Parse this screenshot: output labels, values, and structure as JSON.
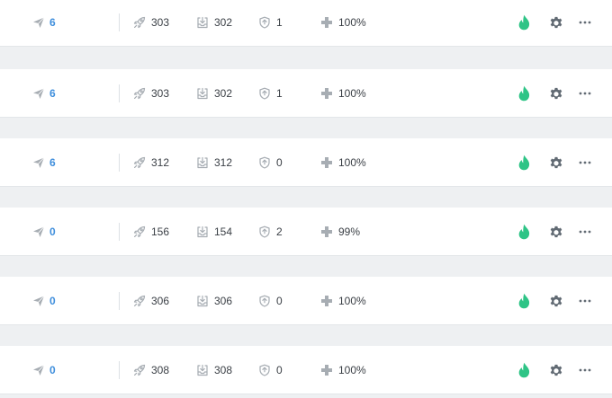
{
  "colors": {
    "accent_blue": "#3e8edc",
    "flame_green": "#2ec486",
    "icon_gray": "#a7adb3",
    "gear_gray": "#616a73"
  },
  "icons": {
    "sent": "paper-plane-icon",
    "launches": "rocket-icon",
    "inbox": "inbox-download-icon",
    "shield": "shield-icon",
    "health": "plus-icon",
    "status": "flame-icon",
    "settings": "gear-icon",
    "more": "ellipsis-icon"
  },
  "rows": [
    {
      "sent": "6",
      "launches": "303",
      "inbox": "302",
      "shield": "1",
      "health": "100%"
    },
    {
      "sent": "6",
      "launches": "303",
      "inbox": "302",
      "shield": "1",
      "health": "100%"
    },
    {
      "sent": "6",
      "launches": "312",
      "inbox": "312",
      "shield": "0",
      "health": "100%"
    },
    {
      "sent": "0",
      "launches": "156",
      "inbox": "154",
      "shield": "2",
      "health": "99%"
    },
    {
      "sent": "0",
      "launches": "306",
      "inbox": "306",
      "shield": "0",
      "health": "100%"
    },
    {
      "sent": "0",
      "launches": "308",
      "inbox": "308",
      "shield": "0",
      "health": "100%"
    }
  ]
}
